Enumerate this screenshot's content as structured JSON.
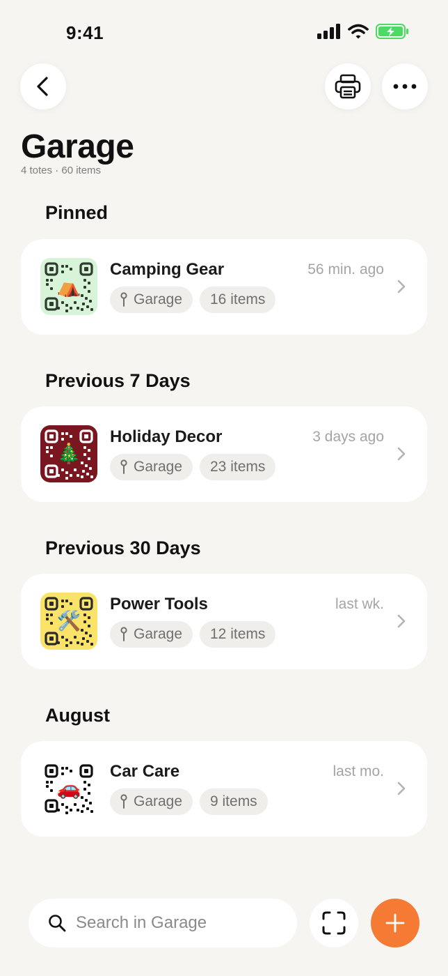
{
  "status_bar": {
    "time": "9:41"
  },
  "header": {
    "title": "Garage",
    "subtitle": "4 totes · 60 items"
  },
  "sections": [
    {
      "title": "Pinned",
      "tote": {
        "name": "Camping Gear",
        "time": "56 min. ago",
        "location": "Garage",
        "count": "16 items",
        "emoji": "⛺",
        "qr_bg": "#d7f3d8",
        "qr_fg": "#2e3b2e"
      }
    },
    {
      "title": "Previous 7 Days",
      "tote": {
        "name": "Holiday Decor",
        "time": "3 days ago",
        "location": "Garage",
        "count": "23 items",
        "emoji": "🎄",
        "qr_bg": "#7a1620",
        "qr_fg": "#ffffff"
      }
    },
    {
      "title": "Previous 30 Days",
      "tote": {
        "name": "Power Tools",
        "time": "last wk.",
        "location": "Garage",
        "count": "12 items",
        "emoji": "🛠️",
        "qr_bg": "#fbe36a",
        "qr_fg": "#2a2a2a"
      }
    },
    {
      "title": "August",
      "tote": {
        "name": "Car Care",
        "time": "last mo.",
        "location": "Garage",
        "count": "9 items",
        "emoji": "🚗",
        "qr_bg": "#ffffff",
        "qr_fg": "#111111"
      }
    }
  ],
  "search": {
    "placeholder": "Search in Garage"
  },
  "icons": {
    "back": "chevron-left-icon",
    "print": "printer-icon",
    "more": "ellipsis-icon",
    "scan": "scan-icon",
    "add": "plus-icon",
    "search": "search-icon",
    "pin": "pin-icon",
    "chevron": "chevron-right-icon"
  },
  "colors": {
    "accent": "#f57b34",
    "background": "#f6f5f1",
    "battery": "#4cd964"
  }
}
